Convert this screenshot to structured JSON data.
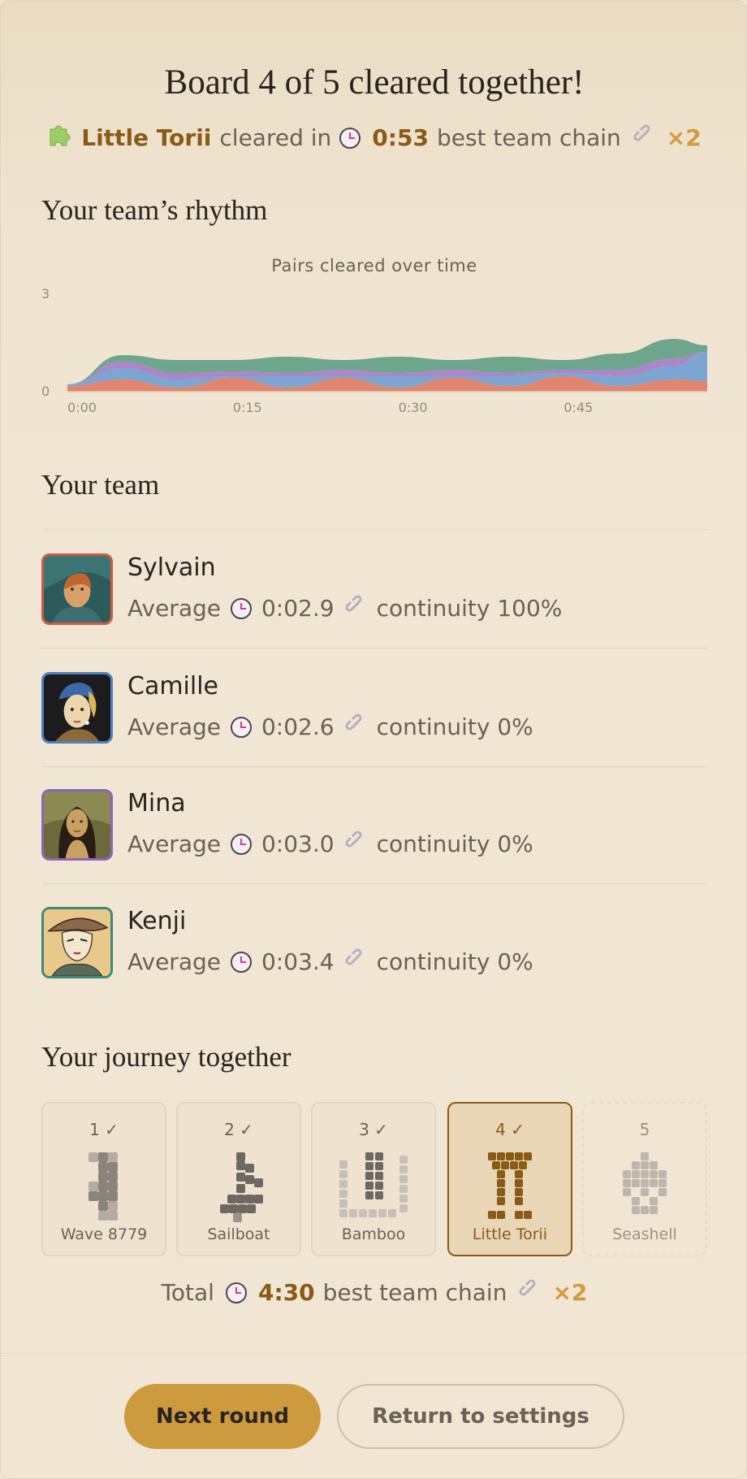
{
  "header": {
    "title": "Board 4 of 5 cleared together!",
    "board_name": "Little Torii",
    "cleared_in_label": "cleared in",
    "time": "0:53",
    "chain_label": "best team chain",
    "chain_multiplier": "×2"
  },
  "rhythm": {
    "heading": "Your team’s rhythm",
    "chart_data": {
      "type": "area",
      "stacked": true,
      "title": "Pairs cleared over time",
      "x": [
        0,
        5,
        10,
        15,
        20,
        25,
        30,
        35,
        40,
        45,
        50,
        55,
        58
      ],
      "x_ticks": [
        "0:00",
        "0:15",
        "0:30",
        "0:45"
      ],
      "x_tick_values": [
        0,
        15,
        30,
        45
      ],
      "y_ticks": [
        "0",
        "3"
      ],
      "ylim": [
        0,
        3
      ],
      "xlim": [
        0,
        58
      ],
      "series": [
        {
          "color": "#e07a63",
          "values": [
            0.15,
            0.35,
            0.1,
            0.4,
            0.1,
            0.4,
            0.1,
            0.4,
            0.15,
            0.45,
            0.15,
            0.35,
            0.3
          ]
        },
        {
          "color": "#6f9fd0",
          "values": [
            0.05,
            0.35,
            0.25,
            0.05,
            0.35,
            0.05,
            0.35,
            0.05,
            0.3,
            0.1,
            0.3,
            0.4,
            0.9
          ]
        },
        {
          "color": "#a27cc8",
          "values": [
            0.0,
            0.2,
            0.2,
            0.15,
            0.1,
            0.2,
            0.1,
            0.2,
            0.1,
            0.1,
            0.2,
            0.25,
            0.0
          ]
        },
        {
          "color": "#5e9f85",
          "values": [
            0.0,
            0.2,
            0.4,
            0.35,
            0.5,
            0.3,
            0.5,
            0.3,
            0.5,
            0.3,
            0.5,
            0.6,
            0.2
          ]
        }
      ]
    }
  },
  "team": {
    "heading": "Your team",
    "average_label": "Average",
    "members": [
      {
        "name": "Sylvain",
        "average": "0:02.9",
        "continuity": "continuity 100%",
        "color": "#cf5a43"
      },
      {
        "name": "Camille",
        "average": "0:02.6",
        "continuity": "continuity 0%",
        "color": "#4f7fbf"
      },
      {
        "name": "Mina",
        "average": "0:03.0",
        "continuity": "continuity 0%",
        "color": "#8f63b8"
      },
      {
        "name": "Kenji",
        "average": "0:03.4",
        "continuity": "continuity 0%",
        "color": "#3e8a72"
      }
    ]
  },
  "journey": {
    "heading": "Your journey together",
    "boards": [
      {
        "num": "1 ✓",
        "name": "Wave 8779",
        "state": "done"
      },
      {
        "num": "2 ✓",
        "name": "Sailboat",
        "state": "done"
      },
      {
        "num": "3 ✓",
        "name": "Bamboo",
        "state": "done"
      },
      {
        "num": "4 ✓",
        "name": "Little Torii",
        "state": "active"
      },
      {
        "num": "5",
        "name": "Seashell",
        "state": "pending"
      }
    ],
    "total_label": "Total",
    "total_time": "4:30",
    "chain_label": "best team chain",
    "chain_multiplier": "×2"
  },
  "actions": {
    "next_label": "Next round",
    "settings_label": "Return to settings"
  },
  "icons": {
    "board": "puzzle-piece-icon",
    "time": "clock-icon",
    "chain": "link-icon"
  },
  "colors": {
    "accent": "#cd9a3d",
    "gold_text": "#8a5a17",
    "multiplier": "#d39a3e",
    "background": "#f1e6d3"
  }
}
